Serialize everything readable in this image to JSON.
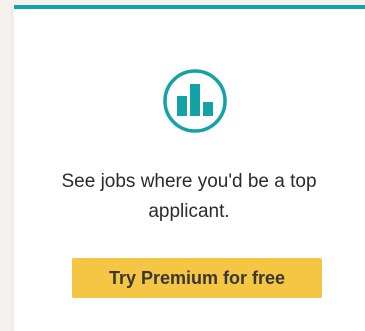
{
  "promo": {
    "icon": "bar-chart-icon",
    "text": "See jobs where you'd be a top applicant.",
    "cta_label": "Try Premium for free"
  },
  "colors": {
    "accent_teal": "#13a3a6",
    "cta_yellow": "#f5c644",
    "text_dark": "#2b2b2b",
    "page_bg": "#f3f2ef",
    "card_bg": "#ffffff"
  }
}
